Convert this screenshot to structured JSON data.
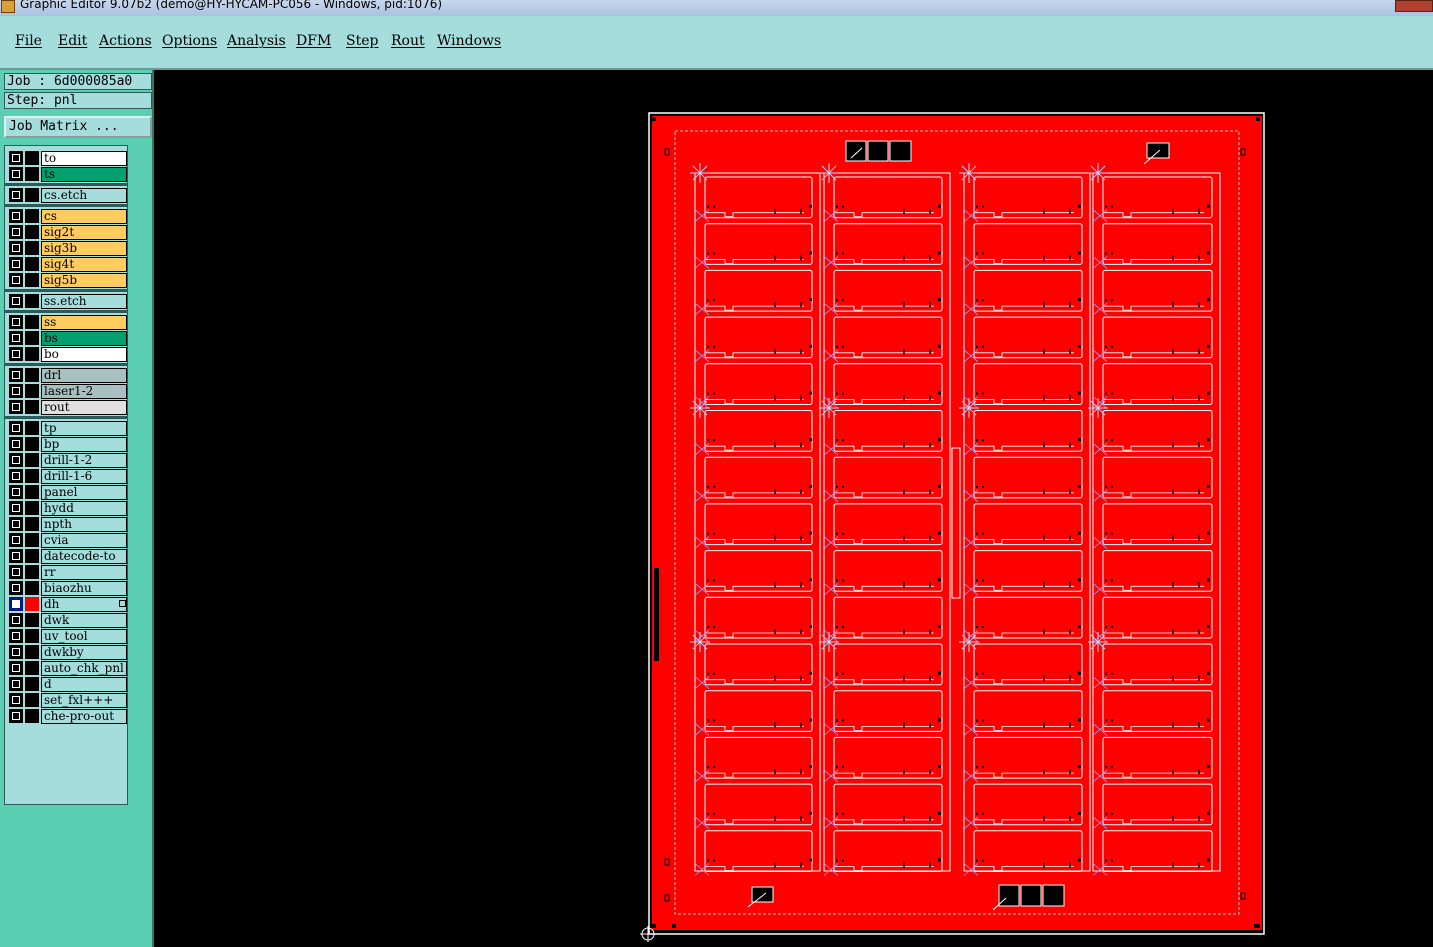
{
  "window": {
    "title": "Graphic Editor 9.07b2 (demo@HY-HYCAM-PC056 - Windows, pid:1076)"
  },
  "menu": [
    "File",
    "Edit",
    "Actions",
    "Options",
    "Analysis",
    "DFM",
    "Step",
    "Rout",
    "Windows"
  ],
  "info": {
    "job": "Job : 6d000085a0",
    "step": "Step: pnl",
    "job_matrix_button": "Job Matrix ..."
  },
  "colors": {
    "board": "#ff0000",
    "layer_white": "#ffffff",
    "layer_green": "#00a070",
    "layer_orange": "#ffcc60",
    "layer_grey": "#a8c0c0",
    "layer_light": "#e0e0e0",
    "layer_teal": "#a5dcdc",
    "active_marker": "#ff0000"
  },
  "layers": [
    {
      "name": "to",
      "bg": "#ffffff"
    },
    {
      "name": "ts",
      "bg": "#00a070"
    },
    {
      "name": "cs.etch",
      "bg": "#a5dcdc"
    },
    {
      "name": "cs",
      "bg": "#ffcc60"
    },
    {
      "name": "sig2t",
      "bg": "#ffcc60"
    },
    {
      "name": "sig3b",
      "bg": "#ffcc60"
    },
    {
      "name": "sig4t",
      "bg": "#ffcc60"
    },
    {
      "name": "sig5b",
      "bg": "#ffcc60"
    },
    {
      "name": "ss.etch",
      "bg": "#a5dcdc"
    },
    {
      "name": "ss",
      "bg": "#ffcc60"
    },
    {
      "name": "bs",
      "bg": "#00a070"
    },
    {
      "name": "bo",
      "bg": "#ffffff"
    },
    {
      "name": "drl",
      "bg": "#a8c0c0"
    },
    {
      "name": "laser1-2",
      "bg": "#a8c0c0"
    },
    {
      "name": "rout",
      "bg": "#e0e0e0"
    },
    {
      "name": "tp",
      "bg": "#a5dcdc"
    },
    {
      "name": "bp",
      "bg": "#a5dcdc"
    },
    {
      "name": "drill-1-2",
      "bg": "#a5dcdc"
    },
    {
      "name": "drill-1-6",
      "bg": "#a5dcdc"
    },
    {
      "name": "panel",
      "bg": "#a5dcdc"
    },
    {
      "name": "hydd",
      "bg": "#a5dcdc"
    },
    {
      "name": "npth",
      "bg": "#a5dcdc"
    },
    {
      "name": "cvia",
      "bg": "#a5dcdc"
    },
    {
      "name": "datecode-to",
      "bg": "#a5dcdc"
    },
    {
      "name": "rr",
      "bg": "#a5dcdc"
    },
    {
      "name": "biaozhu",
      "bg": "#a5dcdc"
    },
    {
      "name": "dh",
      "bg": "#a5dcdc",
      "active": true
    },
    {
      "name": "dwk",
      "bg": "#a5dcdc"
    },
    {
      "name": "uv_tool",
      "bg": "#a5dcdc"
    },
    {
      "name": "dwkby",
      "bg": "#a5dcdc"
    },
    {
      "name": "auto_chk_pnl",
      "bg": "#a5dcdc"
    },
    {
      "name": "d",
      "bg": "#a5dcdc"
    },
    {
      "name": "set_fxl+++",
      "bg": "#a5dcdc"
    },
    {
      "name": "che-pro-out",
      "bg": "#a5dcdc"
    }
  ]
}
